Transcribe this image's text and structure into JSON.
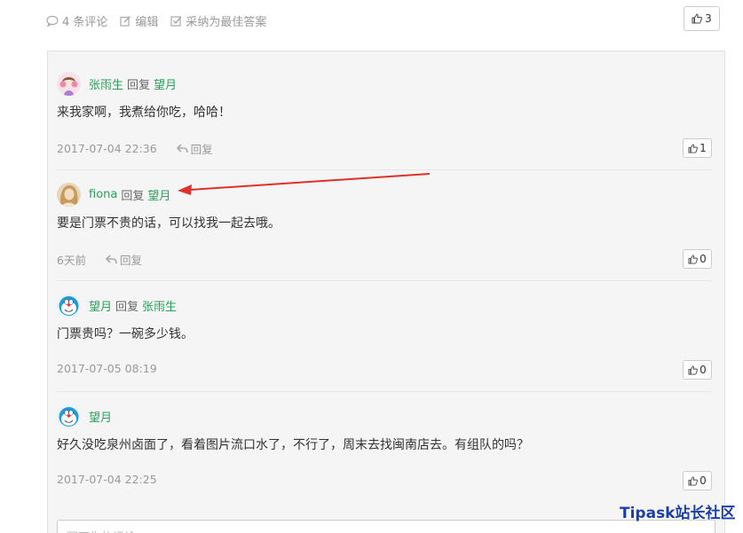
{
  "topbar": {
    "comments_label": "4 条评论",
    "edit_label": "编辑",
    "accept_label": "采纳为最佳答案",
    "like_count": "3"
  },
  "comments": [
    {
      "author": "张雨生",
      "reply_word": "回复",
      "reply_to": "望月",
      "text": "来我家啊，我煮给你吃，哈哈！",
      "time": "2017-07-04 22:36",
      "reply_label": "回复",
      "likes": "1",
      "avatar": "girl-avatar"
    },
    {
      "author": "fiona",
      "reply_word": "回复",
      "reply_to": "望月",
      "text": "要是门票不贵的话，可以找我一起去哦。",
      "time": "6天前",
      "reply_label": "回复",
      "likes": "0",
      "avatar": "fiona-avatar"
    },
    {
      "author": "望月",
      "reply_word": "回复",
      "reply_to": "张雨生",
      "text": "门票贵吗？一碗多少钱。",
      "time": "2017-07-05 08:19",
      "likes": "0",
      "avatar": "doraemon-avatar"
    },
    {
      "author": "望月",
      "text": "好久没吃泉州卤面了，看着图片流口水了，不行了，周末去找闽南店去。有组队的吗？",
      "time": "2017-07-04 22:25",
      "likes": "0",
      "avatar": "doraemon-avatar"
    }
  ],
  "input": {
    "placeholder": "写下你的评论..."
  },
  "watermark": "Tipask站长社区",
  "colors": {
    "name_green": "#2b9e5b",
    "arrow_red": "#e0302a",
    "watermark_blue": "#1a3fa8"
  }
}
